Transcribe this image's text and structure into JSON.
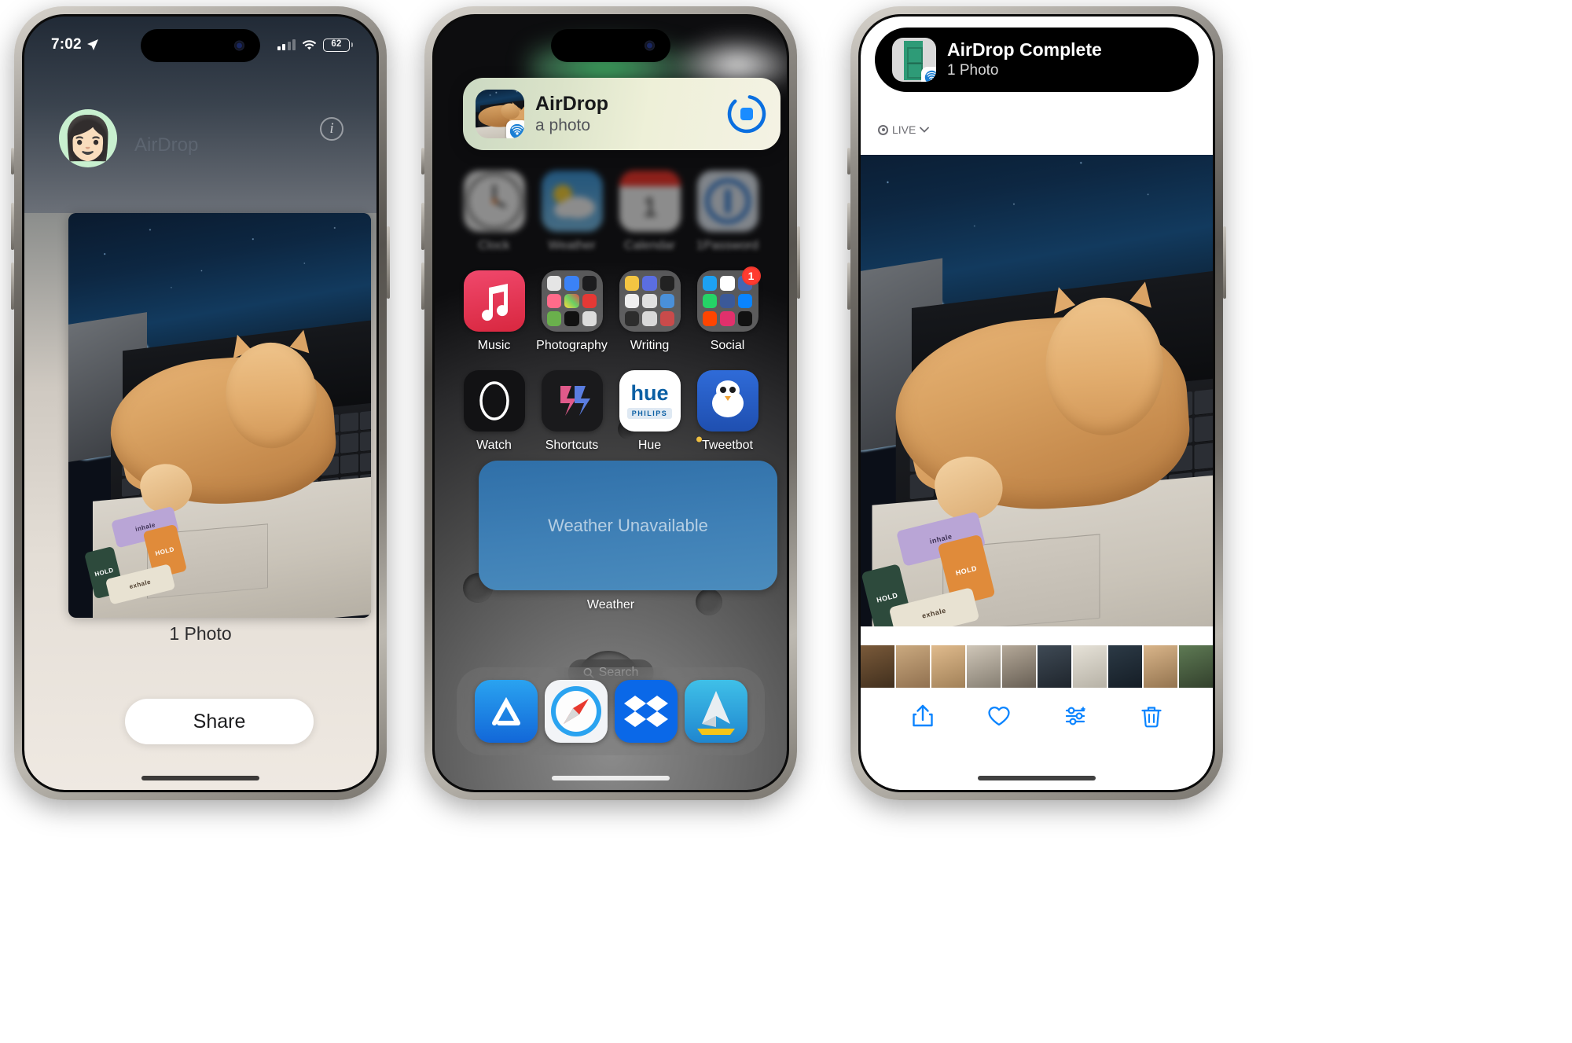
{
  "meta": {
    "scene": "Three iPhone screenshots showing AirDrop send, receive banner, and completion"
  },
  "phone1": {
    "name": "Share sheet — sending",
    "statusbar": {
      "time": "7:02",
      "location_icon": "location-arrow-icon",
      "battery_percent": "62"
    },
    "sheet": {
      "avatar_label": "memoji-avatar",
      "airdrop_label": "AirDrop",
      "info_button": "i",
      "photo_caption": "1 Photo",
      "share_button": "Share"
    }
  },
  "phone2": {
    "name": "Home screen — incoming AirDrop",
    "banner": {
      "app_icon": "airdrop-icon",
      "title": "AirDrop",
      "subtitle": "a photo",
      "accept_button": "stop-transfer-button"
    },
    "apps_row_blurred": [
      {
        "label": "Clock",
        "icon": "clock-icon"
      },
      {
        "label": "Weather",
        "icon": "weather-icon"
      },
      {
        "label": "Calendar",
        "icon": "calendar-icon"
      },
      {
        "label": "1Password",
        "icon": "onepassword-icon"
      }
    ],
    "apps_row_1": [
      {
        "label": "Music",
        "icon": "music-icon",
        "badge": ""
      },
      {
        "label": "Photography",
        "icon": "folder-icon",
        "badge": ""
      },
      {
        "label": "Writing",
        "icon": "folder-icon",
        "badge": ""
      },
      {
        "label": "Social",
        "icon": "folder-icon",
        "badge": "1"
      }
    ],
    "apps_row_2": [
      {
        "label": "Watch",
        "icon": "watch-icon",
        "badge": ""
      },
      {
        "label": "Shortcuts",
        "icon": "shortcuts-icon",
        "badge": ""
      },
      {
        "label": "Hue",
        "icon": "hue-icon",
        "badge": ""
      },
      {
        "label": "Tweetbot",
        "icon": "tweetbot-icon",
        "badge": ""
      }
    ],
    "hue_icon_text": {
      "word": "hue",
      "brand": "PHILIPS"
    },
    "widget": {
      "text": "Weather Unavailable",
      "label": "Weather"
    },
    "search": {
      "label": "Search",
      "icon": "search-icon"
    },
    "dock": [
      {
        "label": "App Store",
        "icon": "appstore-icon"
      },
      {
        "label": "Safari",
        "icon": "safari-icon"
      },
      {
        "label": "Dropbox",
        "icon": "dropbox-icon"
      },
      {
        "label": "Spark",
        "icon": "spark-icon"
      }
    ]
  },
  "phone3": {
    "name": "Photos — AirDrop complete",
    "notification": {
      "title": "AirDrop Complete",
      "subtitle": "1 Photo",
      "thumb": "green-door-photo",
      "badge": "airdrop-icon"
    },
    "live_badge": {
      "label": "LIVE",
      "chevron": "chevron-down-icon"
    },
    "toolbar": [
      {
        "name": "share-button",
        "icon": "share-icon"
      },
      {
        "name": "favorite-button",
        "icon": "heart-icon"
      },
      {
        "name": "edit-button",
        "icon": "adjust-icon"
      },
      {
        "name": "delete-button",
        "icon": "trash-icon"
      }
    ]
  },
  "colors": {
    "ios_blue": "#0a84ff",
    "badge_red": "#ff3b30",
    "music_red": "#e8344e",
    "banner_green": "#cbd9c2"
  }
}
